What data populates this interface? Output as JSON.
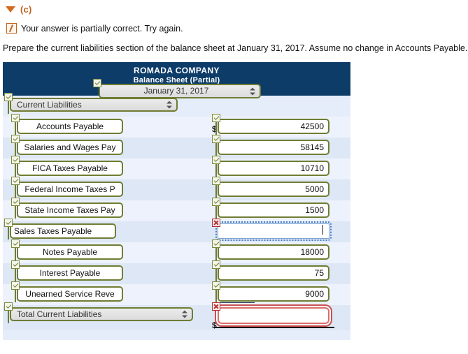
{
  "part": {
    "triangle_icon": "caret-down-icon",
    "label": "(c)"
  },
  "status": {
    "icon": "partially-correct-icon",
    "text": "Your answer is partially correct.  Try again."
  },
  "prompt": "Prepare the current liabilities section of the balance sheet at January 31, 2017. Assume no change in Accounts Payable.",
  "sheet": {
    "company": "ROMADA COMPANY",
    "subtitle": "Balance Sheet (Partial)",
    "date_select": {
      "value": "January 31, 2017",
      "status": "correct"
    },
    "section_select": {
      "value": "Current Liabilities",
      "status": "correct"
    },
    "total_select": {
      "value": "Total Current Liabilities",
      "status": "correct"
    },
    "currency_symbol": "$",
    "rows": [
      {
        "label": "Accounts Payable",
        "label_status": "correct",
        "value": "42500",
        "value_status": "correct",
        "dollar": true
      },
      {
        "label": "Salaries and Wages Pay",
        "label_status": "correct",
        "value": "58145",
        "value_status": "correct",
        "dollar": false
      },
      {
        "label": "FICA Taxes Payable",
        "label_status": "correct",
        "value": "10710",
        "value_status": "correct",
        "dollar": false
      },
      {
        "label": "Federal Income Taxes P",
        "label_status": "correct",
        "value": "5000",
        "value_status": "correct",
        "dollar": false
      },
      {
        "label": "State Income Taxes Pay",
        "label_status": "correct",
        "value": "1500",
        "value_status": "correct",
        "dollar": false
      },
      {
        "label": "Sales Taxes Payable",
        "label_status": "correct",
        "value": "",
        "value_status": "incorrect-focused",
        "dollar": false
      },
      {
        "label": "Notes Payable",
        "label_status": "correct",
        "value": "18000",
        "value_status": "correct",
        "dollar": false
      },
      {
        "label": "Interest Payable",
        "label_status": "correct",
        "value": "75",
        "value_status": "correct",
        "dollar": false
      },
      {
        "label": "Unearned Service Reve",
        "label_status": "correct",
        "value": "9000",
        "value_status": "correct",
        "dollar": false
      }
    ],
    "total_row": {
      "value": "",
      "value_status": "incorrect",
      "dollar": true
    }
  },
  "colors": {
    "header_navy": "#0d3c69",
    "accent_orange": "#c2611b",
    "field_green": "#6f7d33",
    "error_red": "#c94f4f",
    "focus_blue": "#4a7ec0",
    "row_light": "#edf2fd",
    "row_dark": "#dde7f6"
  }
}
